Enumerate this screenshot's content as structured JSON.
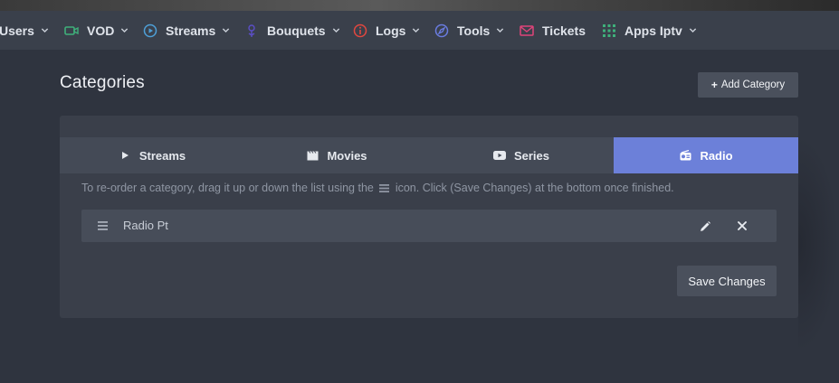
{
  "colors": {
    "page_bg": "#2f343f",
    "navbar_bg": "#3a404b",
    "card_bg": "#3a3f4a",
    "tab_bg": "#444a56",
    "tab_active_bg": "#6c80d9",
    "button_bg": "#4a505c",
    "row_bg": "#474d59",
    "hint_text": "#8f96a3",
    "icon_vod": "#3fb07b",
    "icon_streams": "#4ea0d8",
    "icon_bouquets": "#5b4fc7",
    "icon_logs": "#e2473f",
    "icon_tools": "#6a7ce0",
    "icon_tickets": "#e0447a",
    "icon_apps": "#3fb07b"
  },
  "navbar": {
    "items": [
      {
        "label": "Users",
        "icon": "",
        "dropdown": true
      },
      {
        "label": "VOD",
        "icon": "video-camera-icon",
        "dropdown": true
      },
      {
        "label": "Streams",
        "icon": "play-circle-icon",
        "dropdown": true
      },
      {
        "label": "Bouquets",
        "icon": "flower-icon",
        "dropdown": true
      },
      {
        "label": "Logs",
        "icon": "info-circle-icon",
        "dropdown": true
      },
      {
        "label": "Tools",
        "icon": "compass-icon",
        "dropdown": true
      },
      {
        "label": "Tickets",
        "icon": "envelope-icon",
        "dropdown": false
      },
      {
        "label": "Apps Iptv",
        "icon": "grid-icon",
        "dropdown": true
      }
    ]
  },
  "page": {
    "title": "Categories",
    "add_button_label": "Add Category"
  },
  "tabs": [
    {
      "label": "Streams",
      "icon": "play-icon",
      "active": false
    },
    {
      "label": "Movies",
      "icon": "film-icon",
      "active": false
    },
    {
      "label": "Series",
      "icon": "youtube-icon",
      "active": false
    },
    {
      "label": "Radio",
      "icon": "radio-icon",
      "active": true
    }
  ],
  "hint": {
    "before": "To re-order a category, drag it up or down the list using the",
    "after": "icon. Click (Save Changes) at the bottom once finished."
  },
  "categories": [
    {
      "name": "Radio Pt"
    }
  ],
  "save_button_label": "Save Changes"
}
